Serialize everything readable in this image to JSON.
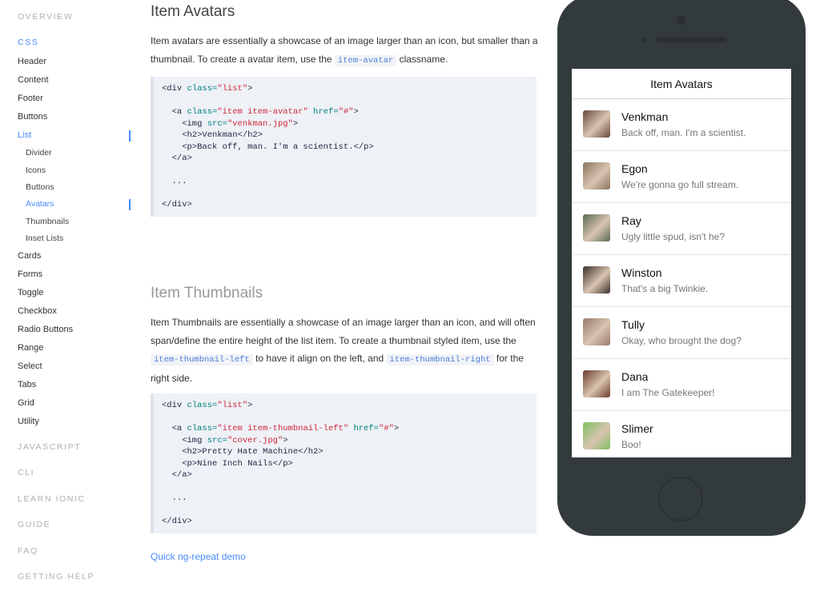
{
  "sidebar": {
    "sections": [
      "Overview",
      "CSS",
      "JavaScript",
      "CLI",
      "Learn Ionic",
      "Guide",
      "FAQ",
      "Getting Help"
    ],
    "items": [
      "Header",
      "Content",
      "Footer",
      "Buttons",
      "List",
      "Cards",
      "Forms",
      "Toggle",
      "Checkbox",
      "Radio Buttons",
      "Range",
      "Select",
      "Tabs",
      "Grid",
      "Utility"
    ],
    "list_sub": [
      "Divider",
      "Icons",
      "Buttons",
      "Avatars",
      "Thumbnails",
      "Inset Lists"
    ],
    "active_section": "CSS",
    "active_item": "List",
    "active_sub": "Avatars",
    "accent_color": "#4a8bfc"
  },
  "main": {
    "avatars": {
      "title": "Item Avatars",
      "para_1": "Item avatars are essentially a showcase of an image larger than an icon, but smaller than a thumbnail. To create a avatar item, use the",
      "class_name": "item-avatar",
      "para_2": "classname."
    },
    "avatars_code": {
      "open_div_tag": "<div",
      "class_attr": " class=",
      "list_str": "\"list\"",
      "gt": ">",
      "a_open": "  <a",
      "a_class_str": "\"item item-avatar\"",
      "href_attr": " href=",
      "hash_str": "\"#\"",
      "img_open": "    <img",
      "src_attr": " src=",
      "src_venkman": "\"venkman.jpg\"",
      "h2_line": "    <h2>Venkman</h2>",
      "p_line": "    <p>Back off, man. I'm a scientist.</p>",
      "a_close": "  </a>",
      "ellipsis": "  ...",
      "div_close": "</div>"
    },
    "thumbnails": {
      "title": "Item Thumbnails",
      "para_1": "Item Thumbnails are essentially a showcase of an image larger than an icon, and will often span/define the entire height of the list item. To create a thumbnail styled item, use the",
      "class_left": "item-thumbnail-left",
      "para_2": "to have it align on the left, and",
      "class_right": "item-thumbnail-right",
      "para_3": "for the right side."
    },
    "thumbnails_code": {
      "a_class_str": "\"item item-thumbnail-left\"",
      "src_cover": "\"cover.jpg\"",
      "h2_line": "    <h2>Pretty Hate Machine</h2>",
      "p_line": "    <p>Nine Inch Nails</p>"
    },
    "demo_link": "Quick ng-repeat demo"
  },
  "phone": {
    "screen_title": "Item Avatars",
    "items": [
      {
        "name": "Venkman",
        "text": "Back off, man. I'm a scientist.",
        "color": "#6a4a3c"
      },
      {
        "name": "Egon",
        "text": "We're gonna go full stream.",
        "color": "#8a7560"
      },
      {
        "name": "Ray",
        "text": "Ugly little spud, isn't he?",
        "color": "#5b6a52"
      },
      {
        "name": "Winston",
        "text": "That's a big Twinkie.",
        "color": "#3c2e2a"
      },
      {
        "name": "Tully",
        "text": "Okay, who brought the dog?",
        "color": "#9a7a6a"
      },
      {
        "name": "Dana",
        "text": "I am The Gatekeeper!",
        "color": "#6b3a2a"
      },
      {
        "name": "Slimer",
        "text": "Boo!",
        "color": "#7fc060"
      }
    ]
  }
}
